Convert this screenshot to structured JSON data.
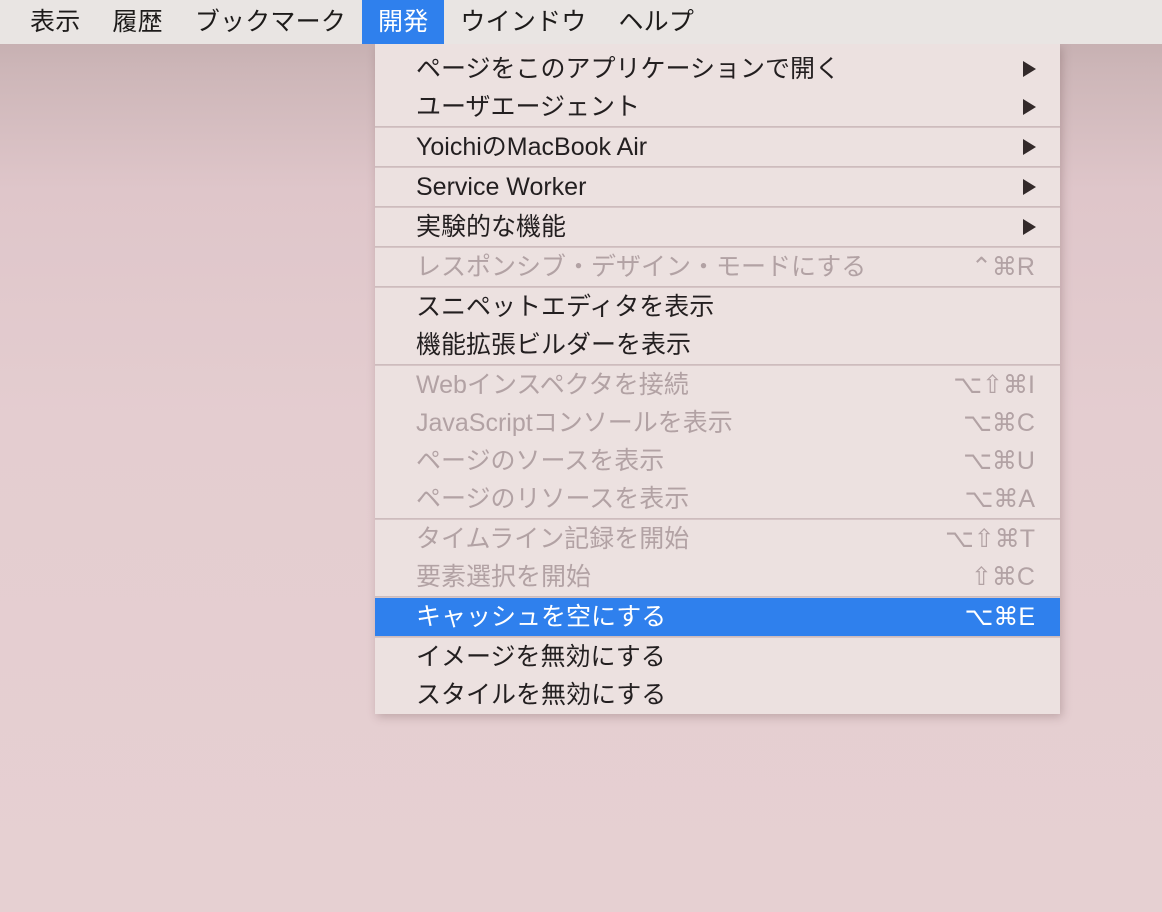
{
  "menubar": {
    "items": [
      {
        "label": "表示",
        "active": false
      },
      {
        "label": "履歴",
        "active": false
      },
      {
        "label": "ブックマーク",
        "active": false
      },
      {
        "label": "開発",
        "active": true
      },
      {
        "label": "ウインドウ",
        "active": false
      },
      {
        "label": "ヘルプ",
        "active": false
      }
    ],
    "background": "#e9e5e3",
    "accent": "#2f80ed"
  },
  "menu": {
    "owner": "開発",
    "background": "#ece1e0",
    "highlight_color": "#2f80ed",
    "disabled_color": "#b2a2a4",
    "groups": [
      {
        "items": [
          {
            "label": "ページをこのアプリケーションで開く",
            "shortcut": "",
            "submenu": true,
            "disabled": false,
            "highlighted": false
          },
          {
            "label": "ユーザエージェント",
            "shortcut": "",
            "submenu": true,
            "disabled": false,
            "highlighted": false
          }
        ]
      },
      {
        "items": [
          {
            "label": "YoichiのMacBook Air",
            "shortcut": "",
            "submenu": true,
            "disabled": false,
            "highlighted": false
          }
        ]
      },
      {
        "items": [
          {
            "label": "Service Worker",
            "shortcut": "",
            "submenu": true,
            "disabled": false,
            "highlighted": false
          }
        ]
      },
      {
        "items": [
          {
            "label": "実験的な機能",
            "shortcut": "",
            "submenu": true,
            "disabled": false,
            "highlighted": false
          }
        ]
      },
      {
        "items": [
          {
            "label": "レスポンシブ・デザイン・モードにする",
            "shortcut": "⌃⌘R",
            "submenu": false,
            "disabled": true,
            "highlighted": false
          }
        ]
      },
      {
        "items": [
          {
            "label": "スニペットエディタを表示",
            "shortcut": "",
            "submenu": false,
            "disabled": false,
            "highlighted": false
          },
          {
            "label": "機能拡張ビルダーを表示",
            "shortcut": "",
            "submenu": false,
            "disabled": false,
            "highlighted": false
          }
        ]
      },
      {
        "items": [
          {
            "label": "Webインスペクタを接続",
            "shortcut": "⌥⇧⌘I",
            "submenu": false,
            "disabled": true,
            "highlighted": false
          },
          {
            "label": "JavaScriptコンソールを表示",
            "shortcut": "⌥⌘C",
            "submenu": false,
            "disabled": true,
            "highlighted": false
          },
          {
            "label": "ページのソースを表示",
            "shortcut": "⌥⌘U",
            "submenu": false,
            "disabled": true,
            "highlighted": false
          },
          {
            "label": "ページのリソースを表示",
            "shortcut": "⌥⌘A",
            "submenu": false,
            "disabled": true,
            "highlighted": false
          }
        ]
      },
      {
        "items": [
          {
            "label": "タイムライン記録を開始",
            "shortcut": "⌥⇧⌘T",
            "submenu": false,
            "disabled": true,
            "highlighted": false
          },
          {
            "label": "要素選択を開始",
            "shortcut": "⇧⌘C",
            "submenu": false,
            "disabled": true,
            "highlighted": false
          }
        ]
      },
      {
        "items": [
          {
            "label": "キャッシュを空にする",
            "shortcut": "⌥⌘E",
            "submenu": false,
            "disabled": false,
            "highlighted": true
          }
        ]
      },
      {
        "items": [
          {
            "label": "イメージを無効にする",
            "shortcut": "",
            "submenu": false,
            "disabled": false,
            "highlighted": false
          },
          {
            "label": "スタイルを無効にする",
            "shortcut": "",
            "submenu": false,
            "disabled": false,
            "highlighted": false
          }
        ]
      }
    ]
  },
  "desktop": {
    "gradient_top": "#bda8a9",
    "gradient_bottom": "#e6d0d2"
  }
}
